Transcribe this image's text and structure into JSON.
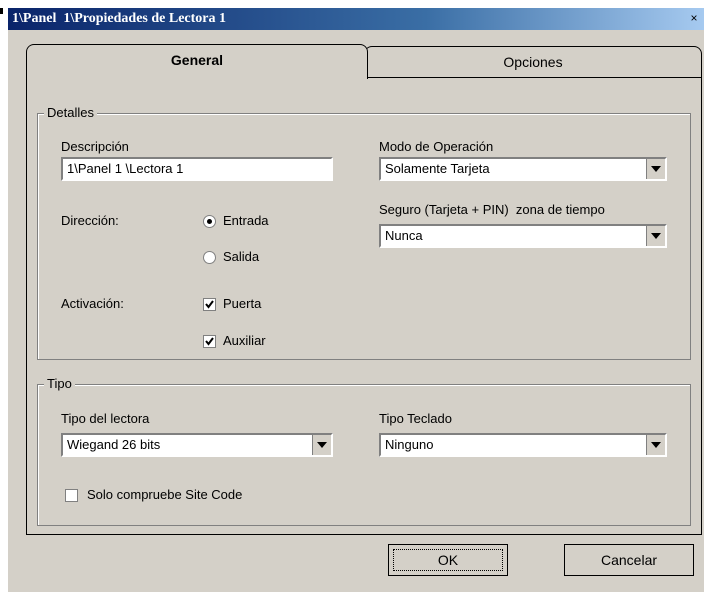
{
  "window": {
    "title": "1\\Panel  1\\Propiedades de Lectora 1",
    "close_label": "×"
  },
  "tabs": [
    {
      "label": "General",
      "active": true
    },
    {
      "label": "Opciones",
      "active": false
    }
  ],
  "detalles": {
    "group_label": "Detalles",
    "descripcion_label": "Descripción",
    "descripcion_value": "1\\Panel 1 \\Lectora 1",
    "modo_label": "Modo de Operación",
    "modo_value": "Solamente Tarjeta",
    "direccion_label": "Dirección:",
    "direccion_options": [
      "Entrada",
      "Salida"
    ],
    "direccion_selected": "Entrada",
    "seguro_label": "Seguro (Tarjeta + PIN)  zona de tiempo",
    "seguro_value": "Nunca",
    "activacion_label": "Activación:",
    "activacion_options": [
      {
        "label": "Puerta",
        "checked": true
      },
      {
        "label": "Auxiliar",
        "checked": true
      }
    ]
  },
  "tipo": {
    "group_label": "Tipo",
    "lectora_label": "Tipo del lectora",
    "lectora_value": "Wiegand 26 bits",
    "teclado_label": "Tipo Teclado",
    "teclado_value": "Ninguno",
    "site_code_label": "Solo compruebe Site Code",
    "site_code_checked": false
  },
  "buttons": {
    "ok": "OK",
    "cancel": "Cancelar"
  }
}
